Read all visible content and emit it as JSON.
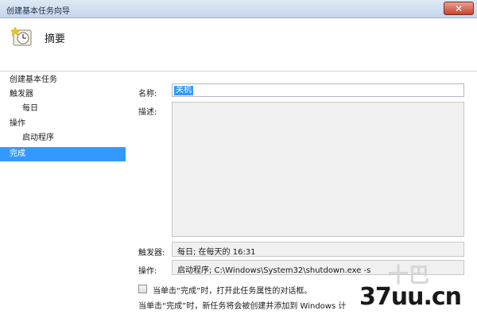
{
  "window": {
    "title": "创建基本任务向导",
    "close_glyph": "✕"
  },
  "header": {
    "title": "摘要"
  },
  "sidebar": {
    "items": [
      {
        "label": "创建基本任务"
      },
      {
        "label": "触发器"
      },
      {
        "label": "每日"
      },
      {
        "label": "操作"
      },
      {
        "label": "启动程序"
      },
      {
        "label": "完成",
        "selected": true
      }
    ]
  },
  "form": {
    "name_label": "名称:",
    "name_value": "关机",
    "description_label": "描述:",
    "description_value": "",
    "trigger_label": "触发器:",
    "trigger_value": "每日; 在每天的 16:31",
    "action_label": "操作:",
    "action_value": "启动程序; C:\\Windows\\System32\\shutdown.exe -s"
  },
  "footer": {
    "checkbox_label": "当单击“完成”时，打开此任务属性的对话框。",
    "checkbox_checked": false,
    "note": "当单击“完成”时，新任务将会被创建并添加到 Windows 计"
  },
  "watermark": {
    "text": "37uu.cn",
    "ghost": "十巴"
  },
  "colors": {
    "selection": "#3399ff",
    "titlebar": "#c4d6ec"
  }
}
